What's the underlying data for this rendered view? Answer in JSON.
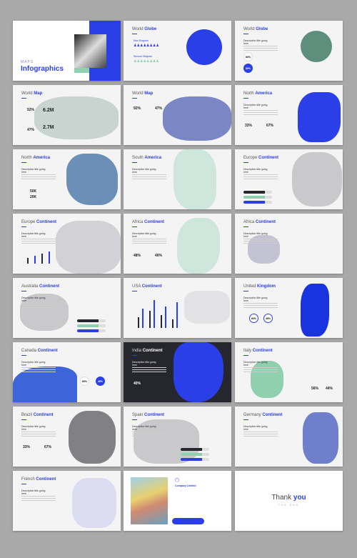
{
  "colors": {
    "background": "#a9a9a9",
    "accent": "#2a3fe8",
    "green": "#8fd0ae",
    "dark": "#26262f",
    "grey": "#c9c9cc"
  },
  "slides": [
    {
      "kind": "cover",
      "eyebrow": "MAPS",
      "title_bold": "Infographics"
    },
    {
      "title_light": "World",
      "title_bold": "Globe",
      "labels": [
        "Man Diagram",
        "Woman Diagram"
      ],
      "map_color": "#2a3fe8"
    },
    {
      "title_light": "World",
      "title_bold": "Globe",
      "desc": "Description title going here",
      "stats": [
        "60%",
        "80%"
      ],
      "map_color": "#5d8f7c"
    },
    {
      "title_light": "World",
      "title_bold": "Map",
      "stats": [
        "52%",
        "47%",
        "6.2M",
        "2.7M"
      ],
      "map_color": "#c9d3cf"
    },
    {
      "title_light": "World",
      "title_bold": "Map",
      "stats": [
        "92%",
        "47%"
      ],
      "map_color": "#7b86c4"
    },
    {
      "title_light": "North",
      "title_bold": "America",
      "desc": "Description title going here",
      "stats": [
        "33%",
        "67%"
      ],
      "map_color": "#2a3fe8"
    },
    {
      "title_light": "North",
      "title_bold": "America",
      "desc": "Description title going here",
      "stats": [
        "50K",
        "20K"
      ],
      "map_color": "#6c8fb8"
    },
    {
      "title_light": "South",
      "title_bold": "America",
      "desc": "Description title going here",
      "map_color": "#cfe6dc"
    },
    {
      "title_light": "Europe",
      "title_bold": "Continent",
      "desc": "Description title going here",
      "map_color": "#c9c9cc"
    },
    {
      "title_light": "Europe",
      "title_bold": "Continent",
      "desc": "Description title going here",
      "map_color": "#d2d2d6"
    },
    {
      "title_light": "Africa",
      "title_bold": "Continent",
      "desc": "Description title going here",
      "stats": [
        "48%",
        "40%"
      ],
      "map_color": "#cfe6dc"
    },
    {
      "title_light": "Africa",
      "title_bold": "Continent",
      "desc": "Description title going here",
      "map_color": "#c3c3d4"
    },
    {
      "title_light": "Australia",
      "title_bold": "Continent",
      "desc": "Description title going here",
      "map_color": "#c9c9cc"
    },
    {
      "title_light": "USA",
      "title_bold": "Continent",
      "map_color": "#e3e3e6"
    },
    {
      "title_light": "United",
      "title_bold": "Kingdom",
      "desc": "Description title going here",
      "stats": [
        "60%",
        "45%"
      ],
      "map_color": "#1a33e0"
    },
    {
      "title_light": "Canada",
      "title_bold": "Continent",
      "desc": "Description title going here",
      "stats": [
        "60%",
        "45%"
      ],
      "map_color": "#3d64d8"
    },
    {
      "kind": "dark",
      "title_light": "India",
      "title_bold": "Continent",
      "desc": "Description title going here",
      "stats": [
        "40%"
      ],
      "map_color": "#2a3fe8"
    },
    {
      "title_light": "Italy",
      "title_bold": "Continent",
      "desc": "Description title going here",
      "stats": [
        "56%",
        "44%"
      ],
      "map_color": "#8fd0ae"
    },
    {
      "title_light": "Brazil",
      "title_bold": "Continent",
      "desc": "Description title going here",
      "stats": [
        "33%",
        "67%"
      ],
      "map_color": "#808085"
    },
    {
      "title_light": "Spain",
      "title_bold": "Continent",
      "desc": "Description title going here",
      "map_color": "#c9c9cc"
    },
    {
      "title_light": "Germany",
      "title_bold": "Continent",
      "desc": "Description title going here",
      "map_color": "#6f7fcc"
    },
    {
      "title_light": "French",
      "title_bold": "Continent",
      "desc": "Description title going here",
      "map_color": "#dcdcf0"
    },
    {
      "kind": "company",
      "company": "Company Limited"
    },
    {
      "kind": "end",
      "title_light": "Thank",
      "title_bold": "you",
      "sub": "THE END"
    }
  ]
}
